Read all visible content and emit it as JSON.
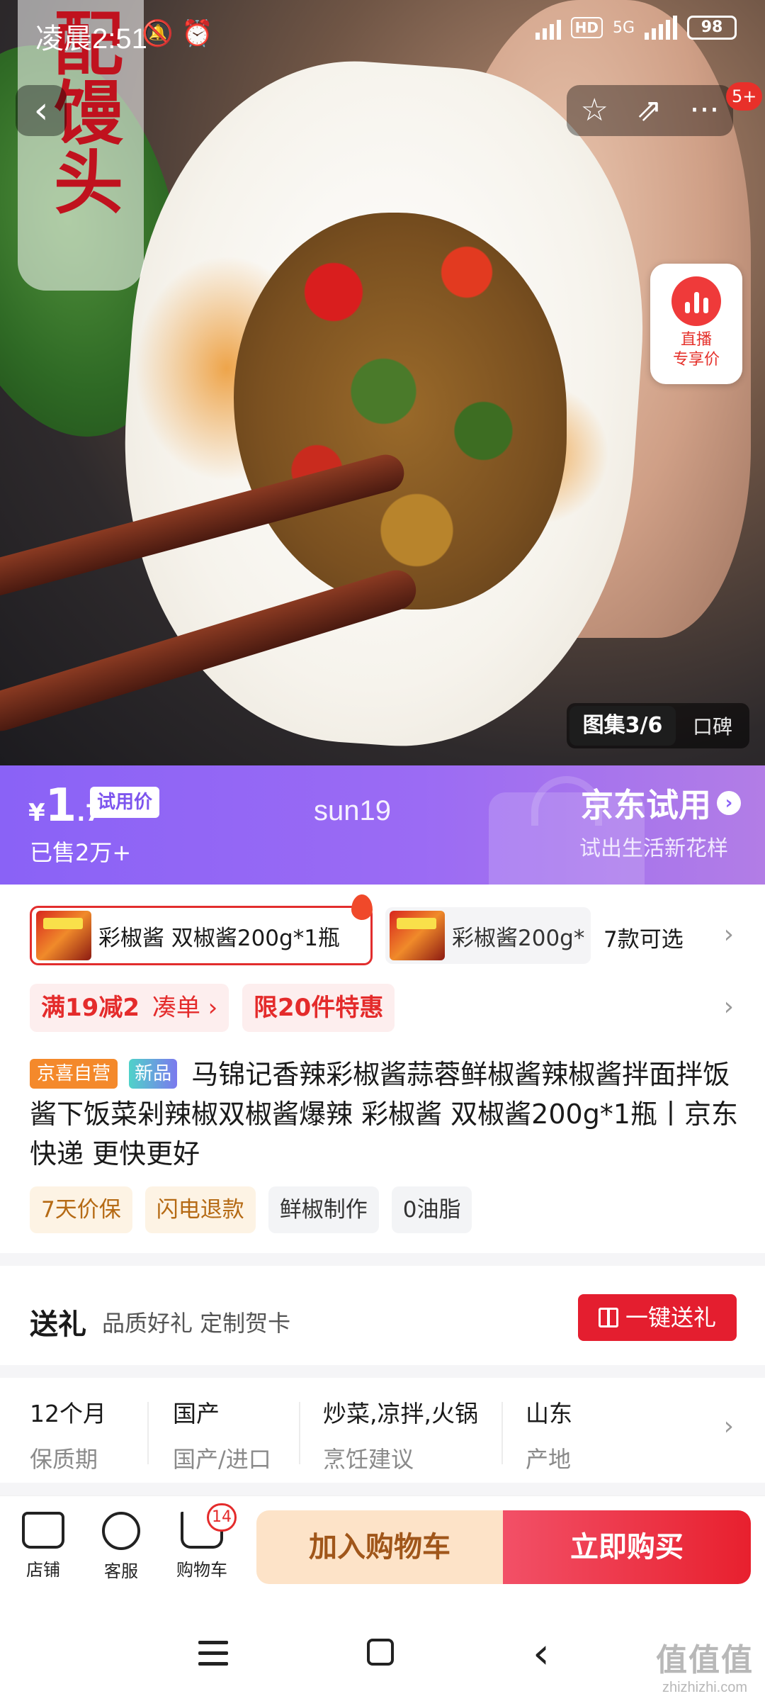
{
  "status_bar": {
    "time": "凌晨2:51",
    "silent_icon": "🔕",
    "alarm_icon": "⏰",
    "hd": "HD",
    "net": "5G",
    "battery": "98"
  },
  "hero": {
    "title_overlay": "配馒头",
    "live": {
      "label_line1": "直播",
      "label_line2": "专享价"
    },
    "gallery": {
      "active_tab": "图集3/6",
      "other_tab": "口碑"
    },
    "notification_badge": "5+",
    "icons": {
      "back": "‹",
      "star": "☆",
      "share": "⇗",
      "more": "···"
    }
  },
  "price_banner": {
    "currency": "¥",
    "price_int": "1",
    "price_dec": ".7",
    "tag": "试用价",
    "sold": "已售2万+",
    "center_label": "sun19",
    "jd_trial": "京东试用",
    "jd_trial_sub": "试出生活新花样",
    "colors": {
      "start": "#8a62f6",
      "end": "#b27de6"
    }
  },
  "variants": {
    "selected": "彩椒酱 双椒酱200g*1瓶",
    "second": "彩椒酱200g*",
    "more": "7款可选"
  },
  "promos": {
    "promo1_main": "满19减2",
    "promo1_action": "凑单 ›",
    "promo2": "限20件特惠"
  },
  "product": {
    "tag_store": "京喜自营",
    "tag_new": "新品",
    "title": "马锦记香辣彩椒酱蒜蓉鲜椒酱辣椒酱拌面拌饭酱下饭菜剁辣椒双椒酱爆辣 彩椒酱 双椒酱200g*1瓶丨京东快递 更快更好",
    "chips": [
      "7天价保",
      "闪电退款",
      "鲜椒制作",
      "0油脂"
    ]
  },
  "gift": {
    "title": "送礼",
    "subtitle": "品质好礼 定制贺卡",
    "button": "一键送礼"
  },
  "specs": [
    {
      "value": "12个月",
      "label": "保质期"
    },
    {
      "value": "国产",
      "label": "国产/进口"
    },
    {
      "value": "炒菜,凉拌,火锅",
      "label": "烹饪建议"
    },
    {
      "value": "山东",
      "label": "产地"
    }
  ],
  "bottom_bar": {
    "shop": "店铺",
    "service": "客服",
    "cart": "购物车",
    "cart_count": "14",
    "add_to_cart": "加入购物车",
    "buy_now": "立即购买"
  },
  "watermark": {
    "big": "值值值",
    "small": "zhizhizhi.com"
  }
}
